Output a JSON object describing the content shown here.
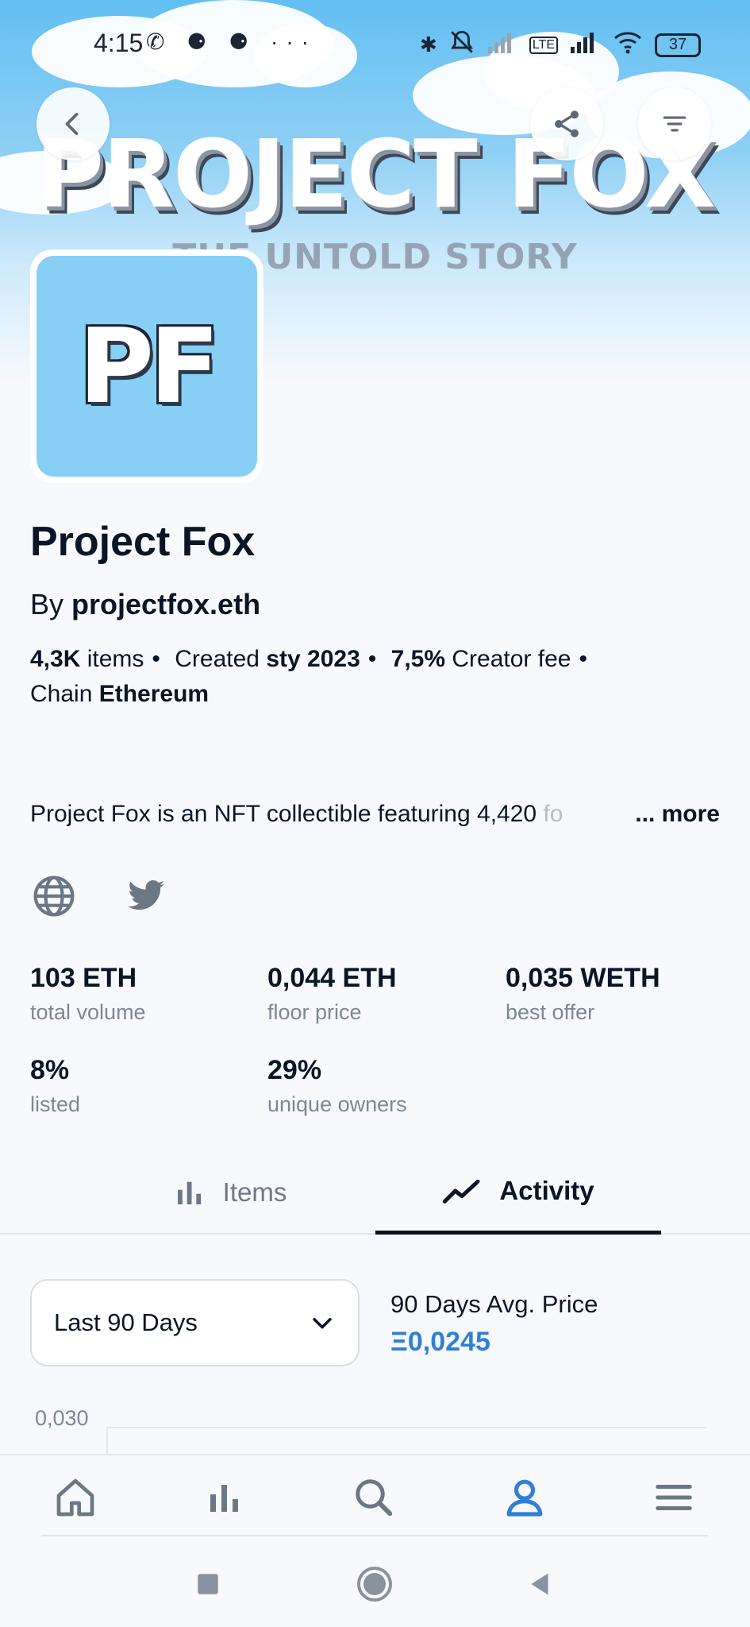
{
  "status_bar": {
    "time": "4:15",
    "left_icons": "✆ ⚈ ⚈ ···",
    "battery": "37"
  },
  "banner": {
    "title": "PROJECT FOX",
    "subtitle": "THE UNTOLD STORY"
  },
  "logo": {
    "text": "PF"
  },
  "collection": {
    "name": "Project Fox",
    "by_prefix": "By",
    "creator": "projectfox.eth",
    "items_value": "4,3K",
    "items_label": "items",
    "created_label": "Created",
    "created_value": "sty 2023",
    "fee_value": "7,5%",
    "fee_label": "Creator fee",
    "chain_label": "Chain",
    "chain_value": "Ethereum",
    "description": "Project Fox is an NFT collectible featuring 4,420",
    "description_fade": " fo",
    "more_label": "... more"
  },
  "stats": {
    "total_volume": {
      "value": "103 ETH",
      "label": "total volume"
    },
    "floor_price": {
      "value": "0,044 ETH",
      "label": "floor price"
    },
    "best_offer": {
      "value": "0,035 WETH",
      "label": "best offer"
    },
    "listed": {
      "value": "8%",
      "label": "listed"
    },
    "unique_owners": {
      "value": "29%",
      "label": "unique owners"
    }
  },
  "tabs": {
    "items": "Items",
    "activity": "Activity",
    "active": "activity"
  },
  "activity": {
    "range_selected": "Last 90 Days",
    "avg_label": "90 Days Avg. Price",
    "avg_value": "Ξ0,0245",
    "chart_top_tick": "0,030"
  },
  "colors": {
    "accent": "#2f7fd8",
    "banner_sky": "#63bff2",
    "logo_bg": "#88cff5"
  }
}
